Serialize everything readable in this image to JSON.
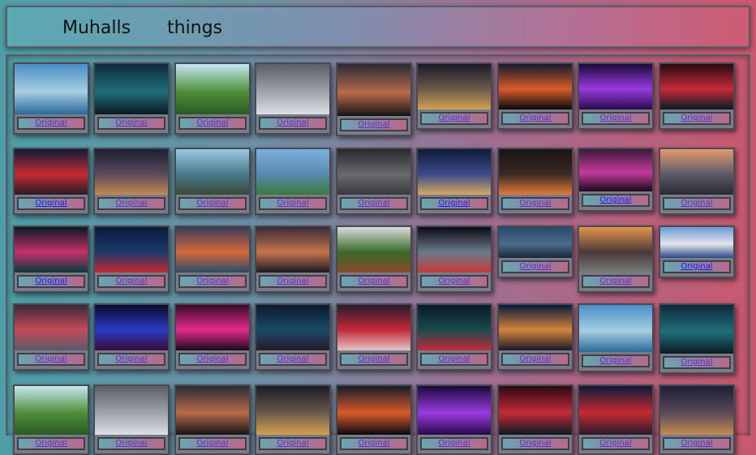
{
  "header": {
    "title_left": "Muhalls",
    "title_right": "things"
  },
  "gallery": {
    "button_label": "Original",
    "rows": [
      [
        {
          "icon": "beach-city-photo",
          "colors": [
            "#4a8fc8",
            "#a7cde0",
            "#2a6a9a"
          ],
          "active": false
        },
        {
          "icon": "aurora-photo",
          "colors": [
            "#0e2a3a",
            "#1f6f78",
            "#0a1a24"
          ],
          "active": false
        },
        {
          "icon": "green-valley-photo",
          "colors": [
            "#c6e6f2",
            "#4f8f3a",
            "#2a5a22"
          ],
          "active": false
        },
        {
          "icon": "snowy-mountain-photo",
          "colors": [
            "#5a5e68",
            "#9ea2aa",
            "#dcdfe4"
          ],
          "active": false
        },
        {
          "icon": "night-mountain-photo",
          "colors": [
            "#2a2a36",
            "#b86a48",
            "#141418"
          ],
          "active": false
        },
        {
          "icon": "city-night-photo",
          "colors": [
            "#1a1a28",
            "#6a5a4a",
            "#d4a050"
          ],
          "active": false
        },
        {
          "icon": "sunset-horizon-photo",
          "colors": [
            "#161c2c",
            "#d85a2a",
            "#080a10"
          ],
          "active": false
        },
        {
          "icon": "neon-triangle-photo",
          "colors": [
            "#1a0a3a",
            "#9a3ae0",
            "#2a0a4a"
          ],
          "active": false
        },
        {
          "icon": "neon-corridor-photo",
          "colors": [
            "#2a0a12",
            "#c42a38",
            "#0a1a22"
          ],
          "active": false
        }
      ],
      [
        {
          "icon": "rainy-street-photo",
          "colors": [
            "#0e1a3a",
            "#c42a30",
            "#2a1a2a"
          ],
          "active": true
        },
        {
          "icon": "city-skyline-night-photo",
          "colors": [
            "#1e1e36",
            "#5a4a5a",
            "#c48a50"
          ],
          "active": false
        },
        {
          "icon": "cable-car-photo",
          "colors": [
            "#9ac8e0",
            "#4a7a8a",
            "#3a4a3a"
          ],
          "active": false
        },
        {
          "icon": "city-panorama-photo",
          "colors": [
            "#7ab0e0",
            "#5a8ab0",
            "#3a7a3a"
          ],
          "active": false
        },
        {
          "icon": "foggy-skyline-photo",
          "colors": [
            "#2a2a2e",
            "#6a6a6e",
            "#3a3a3e"
          ],
          "active": false
        },
        {
          "icon": "harbor-night-photo",
          "colors": [
            "#101a3a",
            "#3a4a8a",
            "#d4a860"
          ],
          "active": true
        },
        {
          "icon": "light-trail-photo",
          "colors": [
            "#1a1414",
            "#3a2a22",
            "#e4783a"
          ],
          "active": false
        },
        {
          "icon": "neon-alley-photo",
          "colors": [
            "#3a1a3a",
            "#c43a9a",
            "#1a0a1a"
          ],
          "active": true
        },
        {
          "icon": "train-station-photo",
          "colors": [
            "#e49a6a",
            "#5a5a6a",
            "#2a2a2e"
          ],
          "active": false
        }
      ],
      [
        {
          "icon": "neon-signs-photo",
          "colors": [
            "#0a1a22",
            "#c4306a",
            "#0a3a3a"
          ],
          "active": true
        },
        {
          "icon": "tokyo-tower-photo",
          "colors": [
            "#0a1a3a",
            "#1a3a6a",
            "#c42a30"
          ],
          "active": false
        },
        {
          "icon": "coastal-village-photo",
          "colors": [
            "#3a3a5a",
            "#d46a3a",
            "#2a4a6a"
          ],
          "active": false
        },
        {
          "icon": "dusk-city-photo",
          "colors": [
            "#3a2a3a",
            "#c4744a",
            "#1a1a24"
          ],
          "active": false
        },
        {
          "icon": "village-mountain-photo",
          "colors": [
            "#dcdcdc",
            "#3a6a2a",
            "#8a4a2a"
          ],
          "active": false
        },
        {
          "icon": "tunnel-train-photo",
          "colors": [
            "#0a0a12",
            "#6a7a8a",
            "#c43a3a"
          ],
          "active": false
        },
        {
          "icon": "shanghai-tower-photo",
          "colors": [
            "#2a4a6a",
            "#4a6a8a",
            "#1a2a3a"
          ],
          "active": false
        },
        {
          "icon": "sunset-bay-photo",
          "colors": [
            "#e4944a",
            "#4a3a3a",
            "#7a7a7a"
          ],
          "active": false
        },
        {
          "icon": "santorini-photo",
          "colors": [
            "#6a9ad4",
            "#e4e4ec",
            "#2a4a8a"
          ],
          "active": true
        }
      ],
      [
        {
          "icon": "wet-street-photo",
          "colors": [
            "#3a2a3a",
            "#c44a5a",
            "#5a5a6a"
          ],
          "active": false
        },
        {
          "icon": "blue-neon-alley-photo",
          "colors": [
            "#0a0a2a",
            "#2a3ac4",
            "#3a0a3a"
          ],
          "active": false
        },
        {
          "icon": "pink-neon-alley-photo",
          "colors": [
            "#3a0a2a",
            "#e42a8a",
            "#1a0a1a"
          ],
          "active": false
        },
        {
          "icon": "dark-shop-photo",
          "colors": [
            "#0a1a2a",
            "#1a4a6a",
            "#2a1a2a"
          ],
          "active": false
        },
        {
          "icon": "highway-trails-photo",
          "colors": [
            "#2a1a2a",
            "#c42a3a",
            "#e4c4c4"
          ],
          "active": false
        },
        {
          "icon": "night-avenue-photo",
          "colors": [
            "#0a1a2a",
            "#1a4a4a",
            "#c42a3a"
          ],
          "active": false
        },
        {
          "icon": "lit-boulevard-photo",
          "colors": [
            "#0a1a3a",
            "#d4843a",
            "#1a1a2a"
          ],
          "active": false
        },
        {
          "icon": "beach-city-photo",
          "colors": [
            "#4a8fc8",
            "#a7cde0",
            "#2a6a9a"
          ],
          "active": false
        },
        {
          "icon": "aurora-photo",
          "colors": [
            "#0e2a3a",
            "#1f6f78",
            "#0a1a24"
          ],
          "active": false
        }
      ],
      [
        {
          "icon": "green-valley-photo",
          "colors": [
            "#c6e6f2",
            "#4f8f3a",
            "#2a5a22"
          ],
          "active": false
        },
        {
          "icon": "snowy-mountain-photo",
          "colors": [
            "#5a5e68",
            "#9ea2aa",
            "#dcdfe4"
          ],
          "active": false
        },
        {
          "icon": "night-mountain-photo",
          "colors": [
            "#2a2a36",
            "#b86a48",
            "#141418"
          ],
          "active": false
        },
        {
          "icon": "city-night-photo",
          "colors": [
            "#1a1a28",
            "#6a5a4a",
            "#d4a050"
          ],
          "active": false
        },
        {
          "icon": "sunset-horizon-photo",
          "colors": [
            "#161c2c",
            "#d85a2a",
            "#080a10"
          ],
          "active": false
        },
        {
          "icon": "neon-triangle-photo",
          "colors": [
            "#1a0a3a",
            "#9a3ae0",
            "#2a0a4a"
          ],
          "active": false
        },
        {
          "icon": "neon-corridor-photo",
          "colors": [
            "#2a0a12",
            "#c42a38",
            "#0a1a22"
          ],
          "active": false
        },
        {
          "icon": "rainy-street-photo",
          "colors": [
            "#0e1a3a",
            "#c42a30",
            "#2a1a2a"
          ],
          "active": false
        },
        {
          "icon": "city-skyline-night-photo",
          "colors": [
            "#1e1e36",
            "#5a4a5a",
            "#c48a50"
          ],
          "active": false
        }
      ]
    ]
  }
}
